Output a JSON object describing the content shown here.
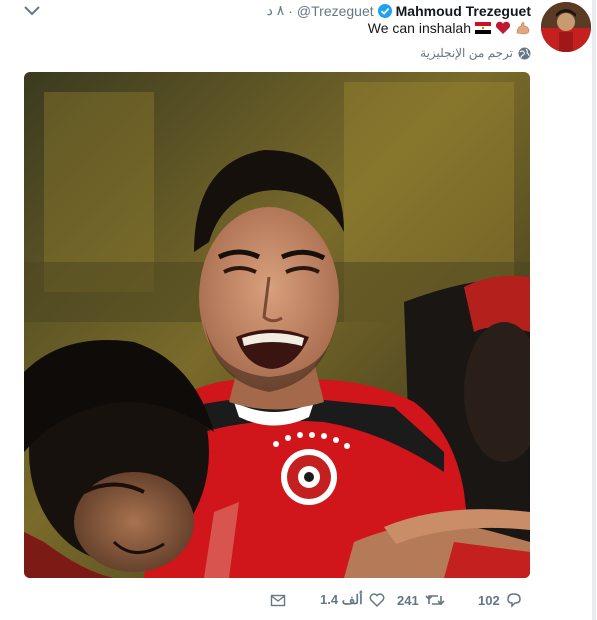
{
  "tweet": {
    "name": "Mahmoud Trezeguet",
    "handle": "@Trezeguet",
    "separator": "·",
    "time": "٨ د",
    "text": "We can inshalah",
    "translate_label": "ترجم من الإنجليزية"
  },
  "actions": {
    "reply_count": "102",
    "retweet_count": "241",
    "like_count": "1.4 ألف"
  },
  "colors": {
    "verified_blue": "#1da1f2",
    "meta_gray": "#657786",
    "text_dark": "#14171a",
    "jersey_red": "#d0161b",
    "heart_red": "#be1931"
  },
  "icons": {
    "caret": "chevron-down-icon",
    "verified": "verified-badge-icon",
    "globe": "globe-icon",
    "reply": "reply-icon",
    "retweet": "retweet-icon",
    "like": "heart-icon",
    "dm": "envelope-icon"
  }
}
